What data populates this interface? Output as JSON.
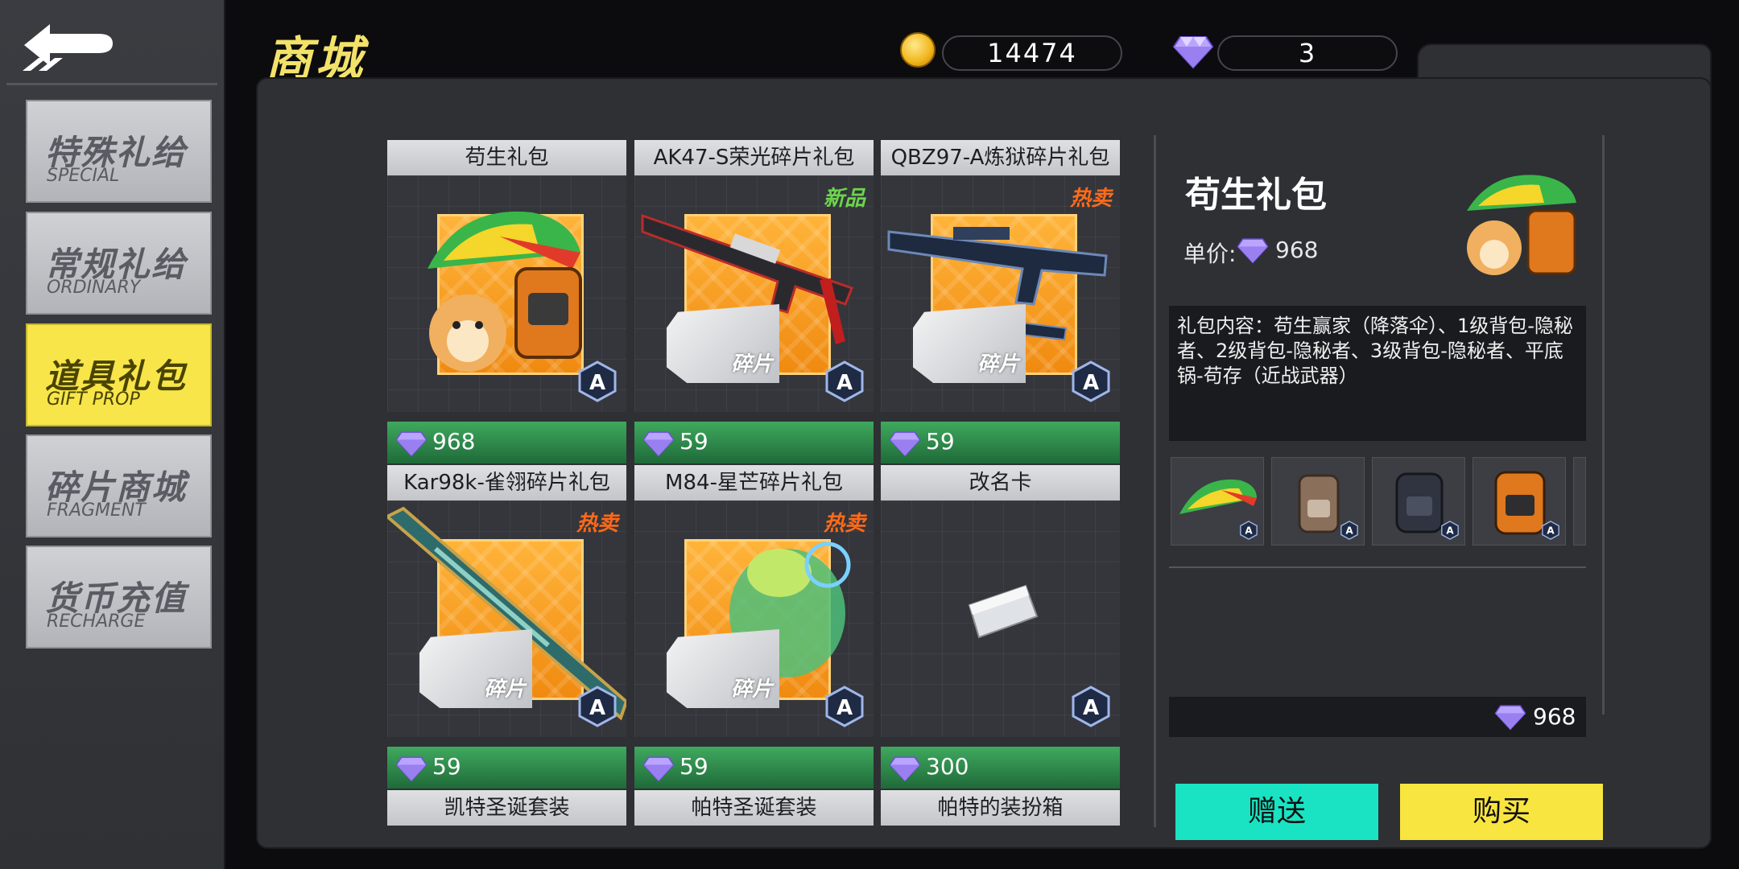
{
  "header": {
    "title": "商城",
    "gold": "14474",
    "gems": "3"
  },
  "sidebar": {
    "items": [
      {
        "zh": "特殊礼给",
        "en": "SPECIAL",
        "active": false
      },
      {
        "zh": "常规礼给",
        "en": "ORDINARY",
        "active": false
      },
      {
        "zh": "道具礼包",
        "en": "GIFT PROP",
        "active": true
      },
      {
        "zh": "碎片商城",
        "en": "FRAGMENT",
        "active": false
      },
      {
        "zh": "货币充值",
        "en": "RECHARGE",
        "active": false
      }
    ]
  },
  "products": [
    {
      "name": "苟生礼包",
      "price": "968",
      "tag": "",
      "grade": "A"
    },
    {
      "name": "AK47-S荣光碎片礼包",
      "price": "59",
      "tag": "新品",
      "grade": "A",
      "shard": "碎片"
    },
    {
      "name": "QBZ97-A炼狱碎片礼包",
      "price": "59",
      "tag": "热卖",
      "grade": "A",
      "shard": "碎片"
    },
    {
      "name": "Kar98k-雀翎碎片礼包",
      "price": "59",
      "tag": "热卖",
      "grade": "A",
      "shard": "碎片"
    },
    {
      "name": "M84-星芒碎片礼包",
      "price": "59",
      "tag": "热卖",
      "grade": "A",
      "shard": "碎片"
    },
    {
      "name": "改名卡",
      "price": "300",
      "tag": "",
      "grade": "A"
    }
  ],
  "next_row": [
    "凯特圣诞套装",
    "帕特圣诞套装",
    "帕特的装扮箱"
  ],
  "detail": {
    "title": "苟生礼包",
    "price_label": "单价:",
    "price": "968",
    "description": "礼包内容：苟生赢家（降落伞）、1级背包-隐秘者、2级背包-隐秘者、3级背包-隐秘者、平底锅-苟存（近战武器）",
    "total": "968",
    "gift_button": "赠送",
    "buy_button": "购买"
  },
  "colors": {
    "accent_yellow": "#f8e53f",
    "accent_teal": "#19e3c3",
    "gem_purple": "#b9a4ff",
    "hot_tag": "#ff6a1a",
    "new_tag": "#6bd64b"
  }
}
